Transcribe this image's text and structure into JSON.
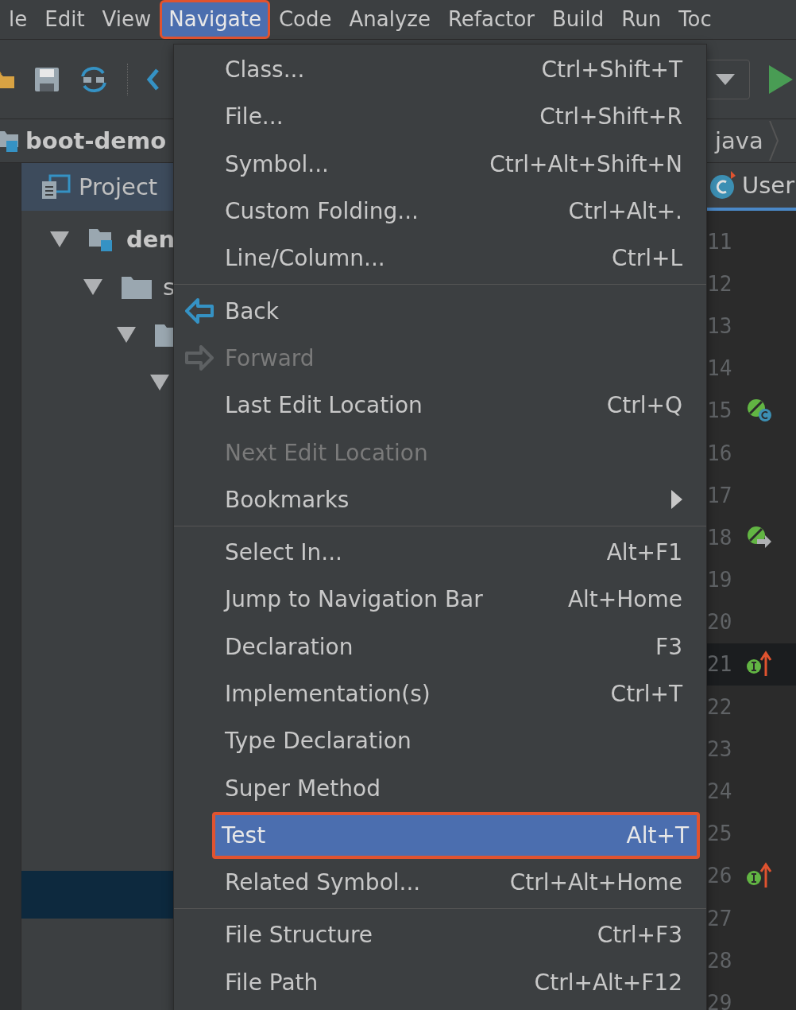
{
  "menubar": [
    {
      "label": "le",
      "selected": false
    },
    {
      "label": "Edit",
      "selected": false
    },
    {
      "label": "View",
      "selected": false
    },
    {
      "label": "Navigate",
      "selected": true
    },
    {
      "label": "Code",
      "selected": false
    },
    {
      "label": "Analyze",
      "selected": false
    },
    {
      "label": "Refactor",
      "selected": false
    },
    {
      "label": "Build",
      "selected": false
    },
    {
      "label": "Run",
      "selected": false
    },
    {
      "label": "Toc",
      "selected": false
    }
  ],
  "breadcrumb": {
    "project": "boot-demo",
    "folder": "java"
  },
  "editor_tab": {
    "label": "User"
  },
  "project_panel": {
    "title": "Project",
    "tree": [
      {
        "label": "den",
        "expanded": true,
        "children": [
          {
            "label": "s",
            "expanded": true,
            "children": [
              {
                "expanded": true,
                "children": [
                  {
                    "expanded": true
                  }
                ]
              }
            ]
          }
        ]
      }
    ]
  },
  "navigate_menu": [
    {
      "kind": "item",
      "label": "Class...",
      "shortcut": "Ctrl+Shift+T",
      "disabled": false,
      "selected": false
    },
    {
      "kind": "item",
      "label": "File...",
      "shortcut": "Ctrl+Shift+R",
      "disabled": false,
      "selected": false
    },
    {
      "kind": "item",
      "label": "Symbol...",
      "shortcut": "Ctrl+Alt+Shift+N",
      "disabled": false,
      "selected": false
    },
    {
      "kind": "item",
      "label": "Custom Folding...",
      "shortcut": "Ctrl+Alt+.",
      "disabled": false,
      "selected": false
    },
    {
      "kind": "item",
      "label": "Line/Column...",
      "shortcut": "Ctrl+L",
      "disabled": false,
      "selected": false
    },
    {
      "kind": "separator"
    },
    {
      "kind": "back",
      "label": "Back",
      "disabled": false,
      "selected": false
    },
    {
      "kind": "forward",
      "label": "Forward",
      "disabled": true,
      "selected": false
    },
    {
      "kind": "item",
      "label": "Last Edit Location",
      "shortcut": "Ctrl+Q",
      "disabled": false,
      "selected": false
    },
    {
      "kind": "item",
      "label": "Next Edit Location",
      "disabled": true,
      "selected": false
    },
    {
      "kind": "submenu",
      "label": "Bookmarks",
      "disabled": false,
      "selected": false
    },
    {
      "kind": "separator"
    },
    {
      "kind": "item",
      "label": "Select In...",
      "shortcut": "Alt+F1",
      "disabled": false,
      "selected": false
    },
    {
      "kind": "item",
      "label": "Jump to Navigation Bar",
      "shortcut": "Alt+Home",
      "disabled": false,
      "selected": false
    },
    {
      "kind": "item",
      "label": "Declaration",
      "shortcut": "F3",
      "disabled": false,
      "selected": false
    },
    {
      "kind": "item",
      "label": "Implementation(s)",
      "shortcut": "Ctrl+T",
      "disabled": false,
      "selected": false
    },
    {
      "kind": "item",
      "label": "Type Declaration",
      "disabled": false,
      "selected": false
    },
    {
      "kind": "item",
      "label": "Super Method",
      "disabled": false,
      "selected": false
    },
    {
      "kind": "item",
      "label": "Test",
      "shortcut": "Alt+T",
      "disabled": false,
      "selected": true
    },
    {
      "kind": "item",
      "label": "Related Symbol...",
      "shortcut": "Ctrl+Alt+Home",
      "disabled": false,
      "selected": false
    },
    {
      "kind": "separator"
    },
    {
      "kind": "item",
      "label": "File Structure",
      "shortcut": "Ctrl+F3",
      "disabled": false,
      "selected": false
    },
    {
      "kind": "item",
      "label": "File Path",
      "shortcut": "Ctrl+Alt+F12",
      "disabled": false,
      "selected": false
    }
  ],
  "gutter": [
    {
      "number": "11",
      "current": false
    },
    {
      "number": "12",
      "current": false
    },
    {
      "number": "13",
      "current": false
    },
    {
      "number": "14",
      "current": false
    },
    {
      "number": "15",
      "current": false,
      "kind": "bean"
    },
    {
      "number": "16",
      "current": false
    },
    {
      "number": "17",
      "current": false
    },
    {
      "number": "18",
      "current": false,
      "kind": "beango"
    },
    {
      "number": "19",
      "current": false
    },
    {
      "number": "20",
      "current": false
    },
    {
      "number": "21",
      "current": true,
      "kind": "implements"
    },
    {
      "number": "22",
      "current": false
    },
    {
      "number": "23",
      "current": false
    },
    {
      "number": "24",
      "current": false
    },
    {
      "number": "25",
      "current": false
    },
    {
      "number": "26",
      "current": false,
      "kind": "implements"
    },
    {
      "number": "27",
      "current": false
    },
    {
      "number": "28",
      "current": false
    },
    {
      "number": "29",
      "current": false
    }
  ]
}
